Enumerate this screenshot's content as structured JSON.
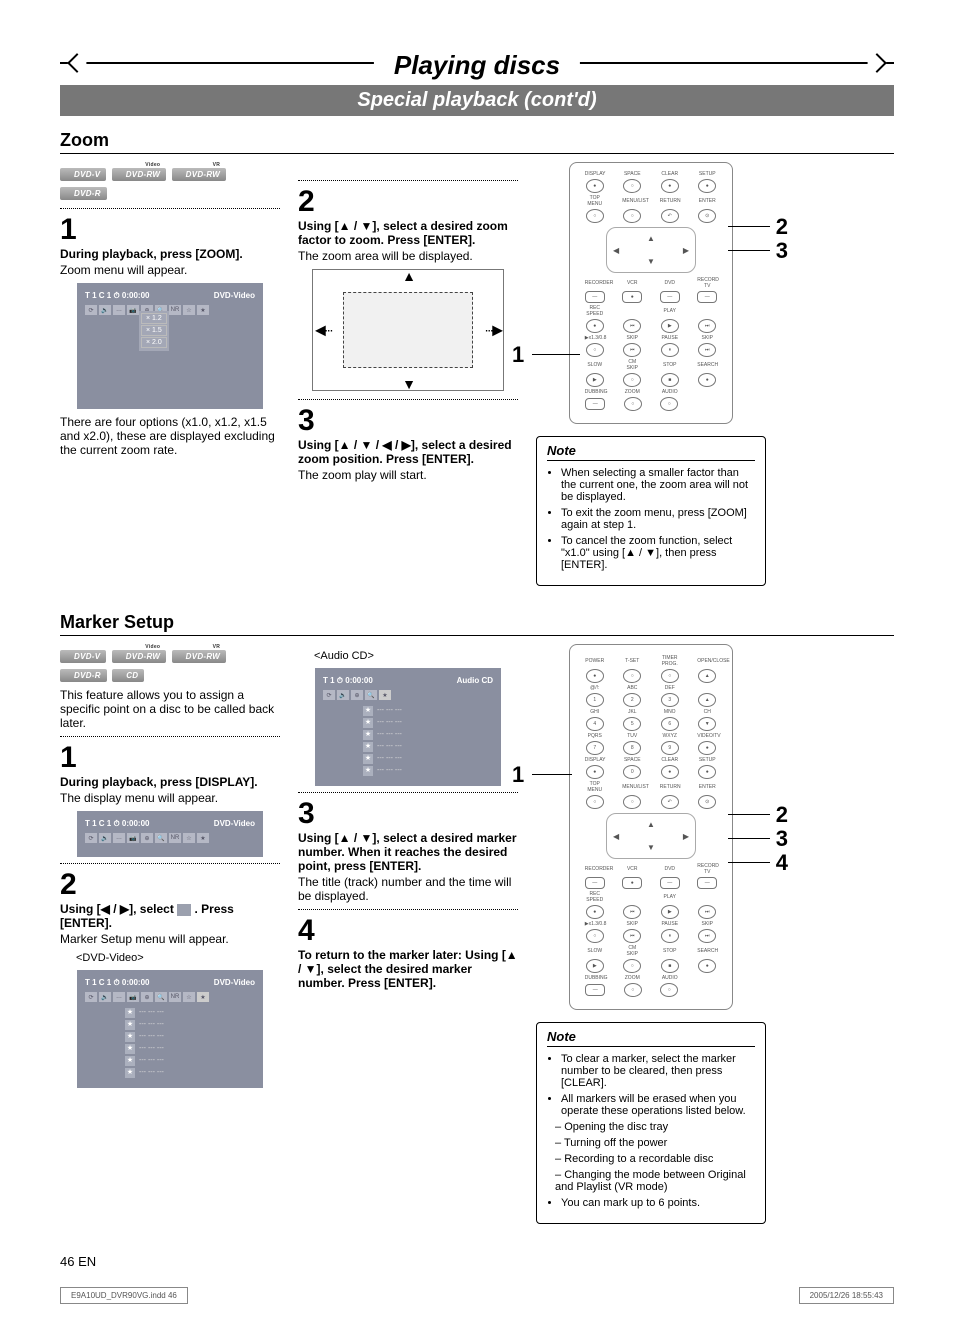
{
  "header": {
    "title": "Playing discs",
    "subtitle": "Special playback (cont'd)"
  },
  "zoom_section": {
    "heading": "Zoom",
    "badges": [
      "DVD-V",
      "DVD-RW",
      "DVD-RW",
      "DVD-R"
    ],
    "badge_sup": [
      "",
      "Video",
      "VR",
      ""
    ],
    "step1": {
      "num": "1",
      "title": "During playback, press [ZOOM].",
      "sub": "Zoom menu will appear.",
      "osd_top_left": "T  1  C 1   ⏱ 0:00:00",
      "osd_top_right": "DVD-Video",
      "zoom_opts": [
        "× 1.2",
        "× 1.5",
        "× 2.0"
      ],
      "after": "There are four options (x1.0, x1.2, x1.5 and x2.0), these are displayed excluding the current zoom rate."
    },
    "step2": {
      "num": "2",
      "title": "Using [▲ / ▼], select a desired zoom factor to zoom. Press [ENTER].",
      "sub": "The zoom area will be displayed."
    },
    "step3": {
      "num": "3",
      "title": "Using [▲ / ▼ / ◀ / ▶], select a desired zoom position. Press [ENTER].",
      "sub": "The zoom play will start."
    },
    "remote_callouts": {
      "left": "1",
      "right_top": "2",
      "right_bot": "3"
    },
    "note": {
      "title": "Note",
      "items": [
        "When selecting a smaller factor than the current one, the zoom area will not be displayed.",
        "To exit the zoom menu, press [ZOOM] again at step 1.",
        "To cancel the zoom function, select \"x1.0\" using [▲ / ▼], then press [ENTER]."
      ]
    }
  },
  "marker_section": {
    "heading": "Marker Setup",
    "badges": [
      "DVD-V",
      "DVD-RW",
      "DVD-RW",
      "DVD-R",
      "CD"
    ],
    "badge_sup": [
      "",
      "Video",
      "VR",
      "",
      ""
    ],
    "intro": "This feature allows you to assign a specific point on a disc to be called back later.",
    "step1": {
      "num": "1",
      "title": "During playback, press [DISPLAY].",
      "sub": "The display menu will appear.",
      "osd_top_left": "T  1  C 1   ⏱ 0:00:00",
      "osd_top_right": "DVD-Video"
    },
    "step2": {
      "num": "2",
      "title_pre": "Using [◀ / ▶], select ",
      "title_post": " . Press [ENTER].",
      "sub": "Marker Setup menu will appear.",
      "label_dvd": "<DVD-Video>",
      "osd_top_left": "T  1  C 1   ⏱ 0:00:00",
      "osd_top_right": "DVD-Video"
    },
    "audio_cd": {
      "label": "<Audio CD>",
      "osd_top_left": "T  1      ⏱ 0:00:00",
      "osd_top_right": "Audio CD"
    },
    "step3": {
      "num": "3",
      "title": "Using [▲ / ▼], select a desired marker number. When it reaches the desired point, press [ENTER].",
      "sub": "The title (track) number and the time will be displayed."
    },
    "step4": {
      "num": "4",
      "title": "To return to the marker later: Using [▲ / ▼], select the desired marker number. Press [ENTER]."
    },
    "remote_callouts": {
      "left": "1",
      "r1": "2",
      "r2": "3",
      "r3": "4"
    },
    "note": {
      "title": "Note",
      "items": [
        "To clear a marker, select the marker number to be cleared, then press [CLEAR].",
        "All markers will be erased when you operate these operations listed below."
      ],
      "dash_items": [
        "Opening the disc tray",
        "Turning off the power",
        "Recording to a recordable disc",
        "Changing the mode between Original and Playlist (VR mode)"
      ],
      "last": "You can mark up to 6 points."
    }
  },
  "remote_labels": {
    "row1": [
      "DISPLAY",
      "SPACE",
      "CLEAR",
      "SETUP"
    ],
    "row2": [
      "TOP MENU",
      "MENU/LIST",
      "RETURN",
      "ENTER"
    ],
    "mid": [
      "RECORDER",
      "VCR",
      "DVD",
      "RECORD TV"
    ],
    "row3": [
      "REC SPEED",
      "",
      "PLAY",
      ""
    ],
    "row4": [
      "▶x1.3/0.8",
      "SKIP",
      "PAUSE",
      "SKIP"
    ],
    "row5": [
      "SLOW",
      "CM SKIP",
      "STOP",
      "SEARCH"
    ],
    "row6": [
      "DUBBING",
      "ZOOM",
      "AUDIO",
      ""
    ],
    "top_rows": {
      "r0": [
        "POWER",
        "T-SET",
        "TIMER PROG.",
        "OPEN/CLOSE"
      ],
      "r1": [
        "@/!:",
        "ABC",
        "DEF",
        ""
      ],
      "r1n": [
        "1",
        "2",
        "3",
        "▲"
      ],
      "r2": [
        "GHI",
        "JKL",
        "MNO",
        "CH"
      ],
      "r2n": [
        "4",
        "5",
        "6",
        "▼"
      ],
      "r3": [
        "PQRS",
        "TUV",
        "WXYZ",
        "VIDEO/TV"
      ],
      "r3n": [
        "7",
        "8",
        "9",
        ""
      ],
      "r4": [
        "DISPLAY",
        "SPACE",
        "CLEAR",
        "SETUP"
      ],
      "r4n": [
        "",
        "0",
        "",
        ""
      ],
      "r5": [
        "TOP MENU",
        "MENU/LIST",
        "RETURN",
        "ENTER"
      ]
    }
  },
  "footer": {
    "page": "46   EN",
    "file": "E9A10UD_DVR90VG.indd   46",
    "date": "2005/12/26   18:55:43"
  }
}
